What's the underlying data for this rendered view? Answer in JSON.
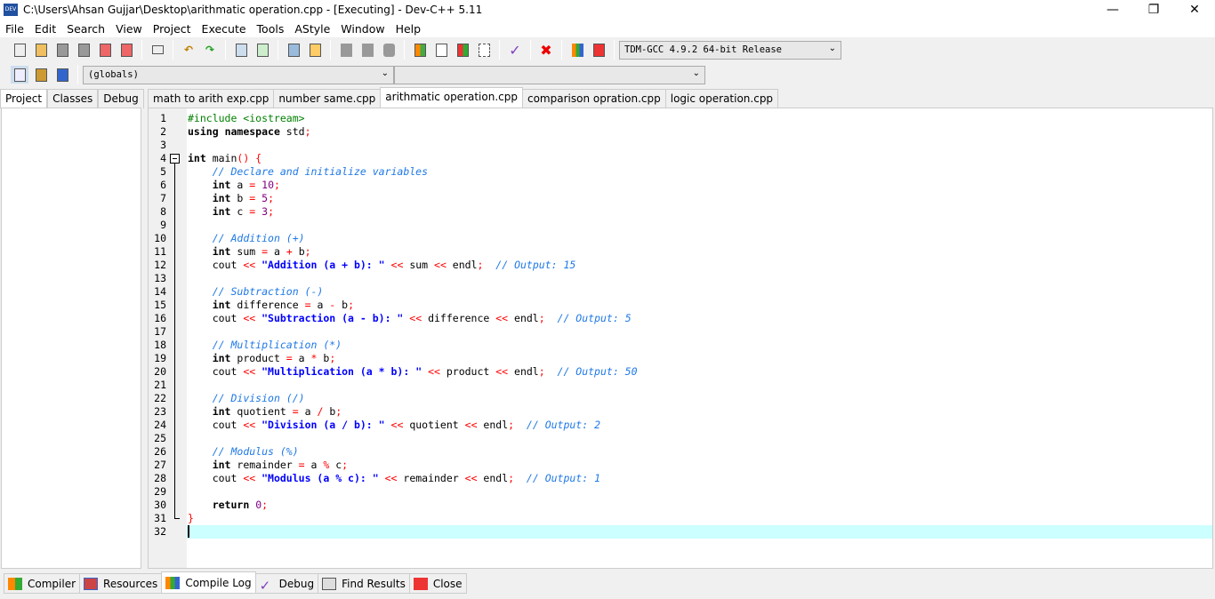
{
  "window": {
    "title": "C:\\Users\\Ahsan Gujjar\\Desktop\\arithmatic operation.cpp - [Executing] - Dev-C++ 5.11",
    "app_icon_text": "DEV"
  },
  "menu": [
    "File",
    "Edit",
    "Search",
    "View",
    "Project",
    "Execute",
    "Tools",
    "AStyle",
    "Window",
    "Help"
  ],
  "toolbar": {
    "compiler_select": "TDM-GCC 4.9.2 64-bit Release",
    "scope_select": "(globals)",
    "function_select": ""
  },
  "left_tabs": [
    {
      "label": "Project",
      "active": true
    },
    {
      "label": "Classes",
      "active": false
    },
    {
      "label": "Debug",
      "active": false
    }
  ],
  "editor_tabs": [
    {
      "label": "math to arith exp.cpp",
      "active": false
    },
    {
      "label": "number same.cpp",
      "active": false
    },
    {
      "label": "arithmatic operation.cpp",
      "active": true
    },
    {
      "label": "comparison opration.cpp",
      "active": false
    },
    {
      "label": "logic operation.cpp",
      "active": false
    }
  ],
  "colors": {
    "keyword": "#000000",
    "preprocessor": "#008000",
    "comment": "#1e78e6",
    "string": "#0000ff",
    "number": "#800080",
    "operator": "#ff0000",
    "current_line": "#ccffff"
  },
  "current_line": 32,
  "code": [
    [
      [
        "p",
        "#include <iostream>"
      ]
    ],
    [
      [
        "k",
        "using"
      ],
      [
        "t",
        " "
      ],
      [
        "k",
        "namespace"
      ],
      [
        "t",
        " std"
      ],
      [
        "o",
        ";"
      ]
    ],
    [],
    [
      [
        "k",
        "int"
      ],
      [
        "t",
        " main"
      ],
      [
        "o",
        "() {"
      ]
    ],
    [
      [
        "t",
        "    "
      ],
      [
        "c",
        "// Declare and initialize variables"
      ]
    ],
    [
      [
        "t",
        "    "
      ],
      [
        "k",
        "int"
      ],
      [
        "t",
        " a "
      ],
      [
        "o",
        "="
      ],
      [
        "t",
        " "
      ],
      [
        "n",
        "10"
      ],
      [
        "o",
        ";"
      ]
    ],
    [
      [
        "t",
        "    "
      ],
      [
        "k",
        "int"
      ],
      [
        "t",
        " b "
      ],
      [
        "o",
        "="
      ],
      [
        "t",
        " "
      ],
      [
        "n",
        "5"
      ],
      [
        "o",
        ";"
      ]
    ],
    [
      [
        "t",
        "    "
      ],
      [
        "k",
        "int"
      ],
      [
        "t",
        " c "
      ],
      [
        "o",
        "="
      ],
      [
        "t",
        " "
      ],
      [
        "n",
        "3"
      ],
      [
        "o",
        ";"
      ]
    ],
    [],
    [
      [
        "t",
        "    "
      ],
      [
        "c",
        "// Addition (+)"
      ]
    ],
    [
      [
        "t",
        "    "
      ],
      [
        "k",
        "int"
      ],
      [
        "t",
        " sum "
      ],
      [
        "o",
        "="
      ],
      [
        "t",
        " a "
      ],
      [
        "o",
        "+"
      ],
      [
        "t",
        " b"
      ],
      [
        "o",
        ";"
      ]
    ],
    [
      [
        "t",
        "    cout "
      ],
      [
        "o",
        "<<"
      ],
      [
        "t",
        " "
      ],
      [
        "s",
        "\"Addition (a + b): \""
      ],
      [
        "t",
        " "
      ],
      [
        "o",
        "<<"
      ],
      [
        "t",
        " sum "
      ],
      [
        "o",
        "<<"
      ],
      [
        "t",
        " endl"
      ],
      [
        "o",
        ";"
      ],
      [
        "t",
        "  "
      ],
      [
        "c",
        "// Output: 15"
      ]
    ],
    [],
    [
      [
        "t",
        "    "
      ],
      [
        "c",
        "// Subtraction (-)"
      ]
    ],
    [
      [
        "t",
        "    "
      ],
      [
        "k",
        "int"
      ],
      [
        "t",
        " difference "
      ],
      [
        "o",
        "="
      ],
      [
        "t",
        " a "
      ],
      [
        "o",
        "-"
      ],
      [
        "t",
        " b"
      ],
      [
        "o",
        ";"
      ]
    ],
    [
      [
        "t",
        "    cout "
      ],
      [
        "o",
        "<<"
      ],
      [
        "t",
        " "
      ],
      [
        "s",
        "\"Subtraction (a - b): \""
      ],
      [
        "t",
        " "
      ],
      [
        "o",
        "<<"
      ],
      [
        "t",
        " difference "
      ],
      [
        "o",
        "<<"
      ],
      [
        "t",
        " endl"
      ],
      [
        "o",
        ";"
      ],
      [
        "t",
        "  "
      ],
      [
        "c",
        "// Output: 5"
      ]
    ],
    [],
    [
      [
        "t",
        "    "
      ],
      [
        "c",
        "// Multiplication (*)"
      ]
    ],
    [
      [
        "t",
        "    "
      ],
      [
        "k",
        "int"
      ],
      [
        "t",
        " product "
      ],
      [
        "o",
        "="
      ],
      [
        "t",
        " a "
      ],
      [
        "o",
        "*"
      ],
      [
        "t",
        " b"
      ],
      [
        "o",
        ";"
      ]
    ],
    [
      [
        "t",
        "    cout "
      ],
      [
        "o",
        "<<"
      ],
      [
        "t",
        " "
      ],
      [
        "s",
        "\"Multiplication (a * b): \""
      ],
      [
        "t",
        " "
      ],
      [
        "o",
        "<<"
      ],
      [
        "t",
        " product "
      ],
      [
        "o",
        "<<"
      ],
      [
        "t",
        " endl"
      ],
      [
        "o",
        ";"
      ],
      [
        "t",
        "  "
      ],
      [
        "c",
        "// Output: 50"
      ]
    ],
    [],
    [
      [
        "t",
        "    "
      ],
      [
        "c",
        "// Division (/)"
      ]
    ],
    [
      [
        "t",
        "    "
      ],
      [
        "k",
        "int"
      ],
      [
        "t",
        " quotient "
      ],
      [
        "o",
        "="
      ],
      [
        "t",
        " a "
      ],
      [
        "o",
        "/"
      ],
      [
        "t",
        " b"
      ],
      [
        "o",
        ";"
      ]
    ],
    [
      [
        "t",
        "    cout "
      ],
      [
        "o",
        "<<"
      ],
      [
        "t",
        " "
      ],
      [
        "s",
        "\"Division (a / b): \""
      ],
      [
        "t",
        " "
      ],
      [
        "o",
        "<<"
      ],
      [
        "t",
        " quotient "
      ],
      [
        "o",
        "<<"
      ],
      [
        "t",
        " endl"
      ],
      [
        "o",
        ";"
      ],
      [
        "t",
        "  "
      ],
      [
        "c",
        "// Output: 2"
      ]
    ],
    [],
    [
      [
        "t",
        "    "
      ],
      [
        "c",
        "// Modulus (%)"
      ]
    ],
    [
      [
        "t",
        "    "
      ],
      [
        "k",
        "int"
      ],
      [
        "t",
        " remainder "
      ],
      [
        "o",
        "="
      ],
      [
        "t",
        " a "
      ],
      [
        "o",
        "%"
      ],
      [
        "t",
        " c"
      ],
      [
        "o",
        ";"
      ]
    ],
    [
      [
        "t",
        "    cout "
      ],
      [
        "o",
        "<<"
      ],
      [
        "t",
        " "
      ],
      [
        "s",
        "\"Modulus (a % c): \""
      ],
      [
        "t",
        " "
      ],
      [
        "o",
        "<<"
      ],
      [
        "t",
        " remainder "
      ],
      [
        "o",
        "<<"
      ],
      [
        "t",
        " endl"
      ],
      [
        "o",
        ";"
      ],
      [
        "t",
        "  "
      ],
      [
        "c",
        "// Output: 1"
      ]
    ],
    [],
    [
      [
        "t",
        "    "
      ],
      [
        "k",
        "return"
      ],
      [
        "t",
        " "
      ],
      [
        "n",
        "0"
      ],
      [
        "o",
        ";"
      ]
    ],
    [
      [
        "o",
        "}"
      ]
    ],
    []
  ],
  "bottom_tabs": [
    {
      "label": "Compiler",
      "icon": "compiler-grid-icon",
      "active": false
    },
    {
      "label": "Resources",
      "icon": "resources-icon",
      "active": false
    },
    {
      "label": "Compile Log",
      "icon": "bar-chart-icon",
      "active": true
    },
    {
      "label": "Debug",
      "icon": "checkmark-icon",
      "active": false
    },
    {
      "label": "Find Results",
      "icon": "find-magnifier-icon",
      "active": false
    },
    {
      "label": "Close",
      "icon": "close-red-x-icon",
      "active": false
    }
  ]
}
